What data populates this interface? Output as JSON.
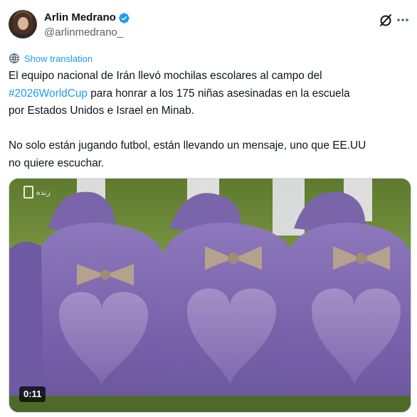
{
  "author": {
    "display_name": "Arlin Medrano",
    "handle": "@arlinmedrano_",
    "verified": true
  },
  "header_actions": {
    "grok_icon": "grok-slash-icon",
    "more_icon": "more-horizontal-icon"
  },
  "translate": {
    "label": "Show translation",
    "icon": "globe-translate-icon"
  },
  "tweet": {
    "line1_before": "El equipo nacional de Irán llevó mochilas escolares al campo del",
    "hashtag": "#2026WorldCup",
    "line2_after": " para honrar a los 175 niñas asesinadas en la escuela",
    "line3": "por Estados Unidos e Israel en Minab.",
    "paragraph2_line1": "No solo están jugando futbol, están llevando un mensaje, uno que EE.UU",
    "paragraph2_line2": "no quiere escuchar."
  },
  "media": {
    "type": "video",
    "duration": "0:11",
    "watermark_text": "زنده",
    "colors": {
      "grass": "#6f8a3a",
      "backpack": "#8a72b8",
      "backpack_dark": "#5c4a8c",
      "bow": "#b9a792"
    }
  }
}
